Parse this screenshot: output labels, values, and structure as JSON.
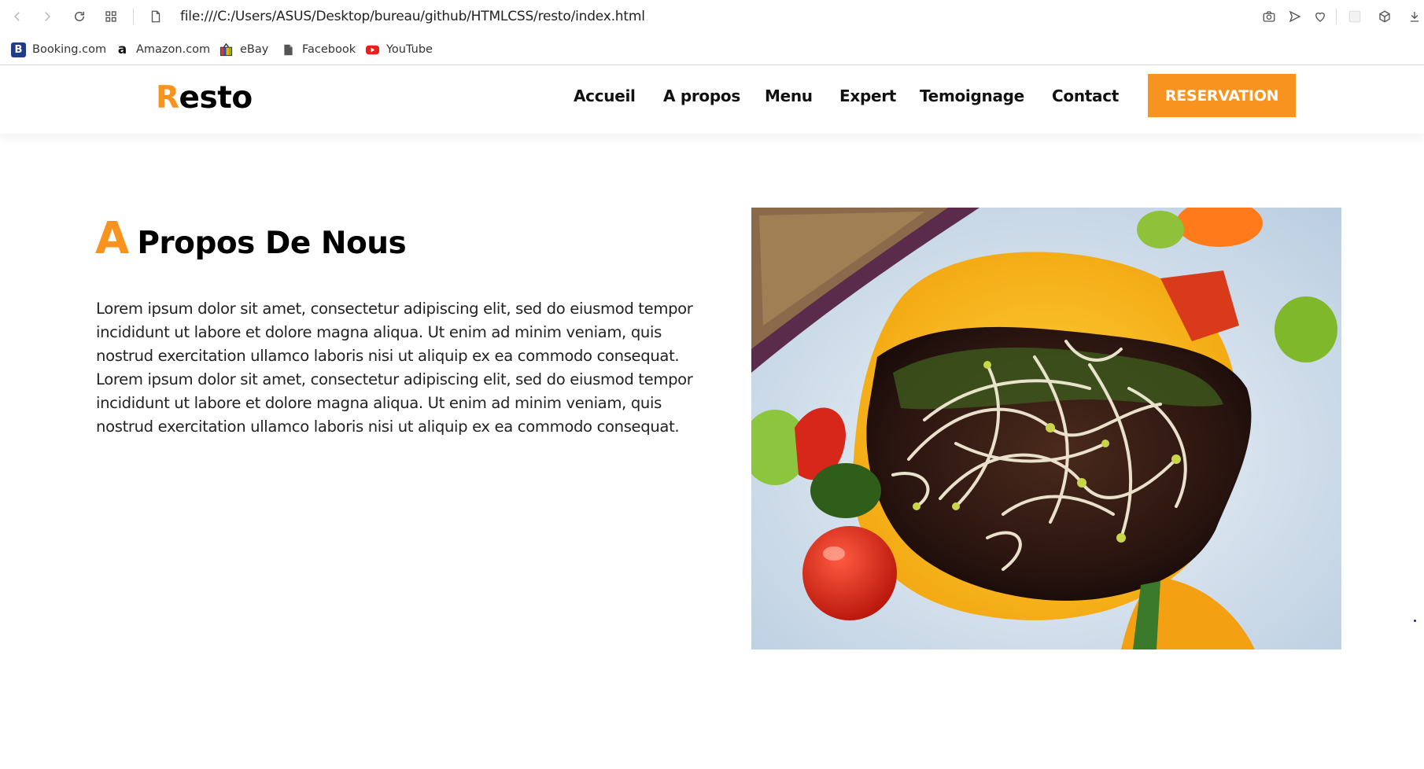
{
  "browser": {
    "url": "file:///C:/Users/ASUS/Desktop/bureau/github/HTMLCSS/resto/index.html",
    "bookmarks": [
      {
        "label": "Booking.com",
        "icon": "booking-icon"
      },
      {
        "label": "Amazon.com",
        "icon": "amazon-icon"
      },
      {
        "label": "eBay",
        "icon": "ebay-icon"
      },
      {
        "label": "Facebook",
        "icon": "document-icon"
      },
      {
        "label": "YouTube",
        "icon": "youtube-icon"
      }
    ]
  },
  "header": {
    "logo_first": "R",
    "logo_rest": "esto",
    "nav": [
      "Accueil",
      "A propos",
      "Menu",
      "Expert",
      "Temoignage",
      "Contact"
    ],
    "cta": "RESERVATION"
  },
  "about": {
    "title_first": "A",
    "title_rest": "Propos De Nous",
    "text": "Lorem ipsum dolor sit amet, consectetur adipiscing elit, sed do eiusmod tempor incididunt ut labore et dolore magna aliqua. Ut enim ad minim veniam, quis nostrud exercitation ullamco laboris nisi ut aliquip ex ea commodo consequat. Lorem ipsum dolor sit amet, consectetur adipiscing elit, sed do eiusmod tempor incididunt ut labore et dolore magna aliqua. Ut enim ad minim veniam, quis nostrud exercitation ullamco laboris nisi ut aliquip ex ea commodo consequat."
  },
  "colors": {
    "accent": "#f7931e",
    "text": "#111111"
  }
}
